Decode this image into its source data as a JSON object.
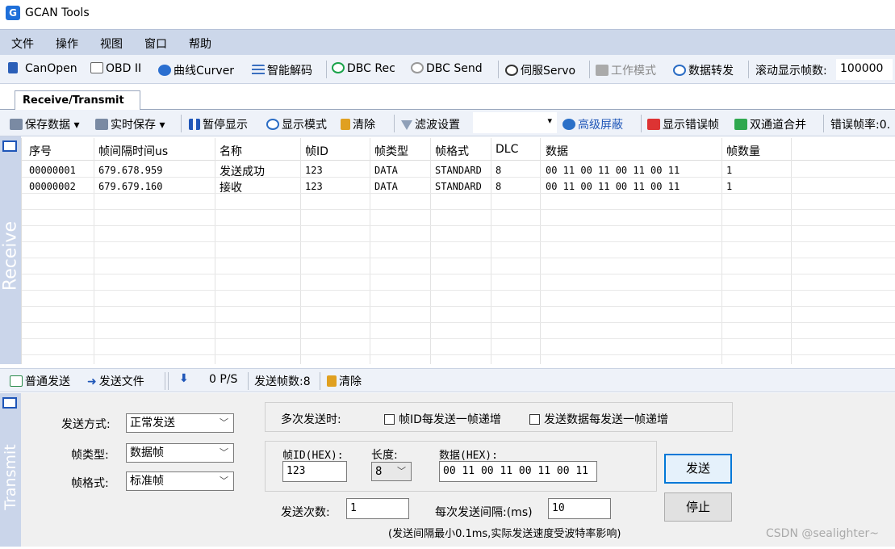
{
  "app": {
    "title": "GCAN Tools",
    "icon": "G"
  },
  "menu": [
    "文件",
    "操作",
    "视图",
    "窗口",
    "帮助"
  ],
  "toolbar1": {
    "items": [
      "CanOpen",
      "OBD II",
      "曲线Curver",
      "智能解码",
      "DBC Rec",
      "DBC Send",
      "伺服Servo",
      "工作模式",
      "数据转发"
    ],
    "scroll_label": "滚动显示帧数:",
    "scroll_value": "100000"
  },
  "tab": "Receive/Transmit",
  "toolbar2": {
    "save_data": "保存数据",
    "realtime_save": "实时保存",
    "pause": "暂停显示",
    "display_mode": "显示模式",
    "clear": "清除",
    "filter": "滤波设置",
    "advanced_mask": "高级屏蔽",
    "show_error": "显示错误帧",
    "merge": "双通道合并",
    "error_rate": "错误帧率:0."
  },
  "sidebar": {
    "receive": "Receive",
    "transmit": "Transmit"
  },
  "grid": {
    "columns": [
      "序号",
      "帧间隔时间us",
      "名称",
      "帧ID",
      "帧类型",
      "帧格式",
      "DLC",
      "数据",
      "帧数量"
    ],
    "rows": [
      [
        "00000001",
        "679.678.959",
        "发送成功",
        "123",
        "DATA",
        "STANDARD",
        "8",
        "00 11 00 11 00 11 00 11",
        "1"
      ],
      [
        "00000002",
        "679.679.160",
        "接收",
        "123",
        "DATA",
        "STANDARD",
        "8",
        "00 11 00 11 00 11 00 11",
        "1"
      ]
    ]
  },
  "toolbar3": {
    "normal_send": "普通发送",
    "send_file": "发送文件",
    "rate": "0 P/S",
    "sent_frames": "发送帧数:8",
    "clear": "清除"
  },
  "transmit": {
    "send_mode_label": "发送方式:",
    "send_mode_value": "正常发送",
    "frame_type_label": "帧类型:",
    "frame_type_value": "数据帧",
    "frame_format_label": "帧格式:",
    "frame_format_value": "标准帧",
    "multi_send_label": "多次发送时:",
    "id_increment": "帧ID每发送一帧递增",
    "data_increment": "发送数据每发送一帧递增",
    "frame_id_label": "帧ID(HEX):",
    "frame_id_value": "123",
    "length_label": "长度:",
    "length_value": "8",
    "data_label": "数据(HEX):",
    "data_value": "00 11 00 11 00 11 00 11",
    "send_button": "发送",
    "stop_button": "停止",
    "send_count_label": "发送次数:",
    "send_count_value": "1",
    "interval_label": "每次发送间隔:(ms)",
    "interval_value": "10",
    "note": "(发送间隔最小0.1ms,实际发送速度受波特率影响)"
  },
  "watermark": "CSDN @sealighter~",
  "colors": {
    "menubar": "#ccd7ea",
    "sidebar": "#cad5ea",
    "accent": "#0078d7"
  }
}
